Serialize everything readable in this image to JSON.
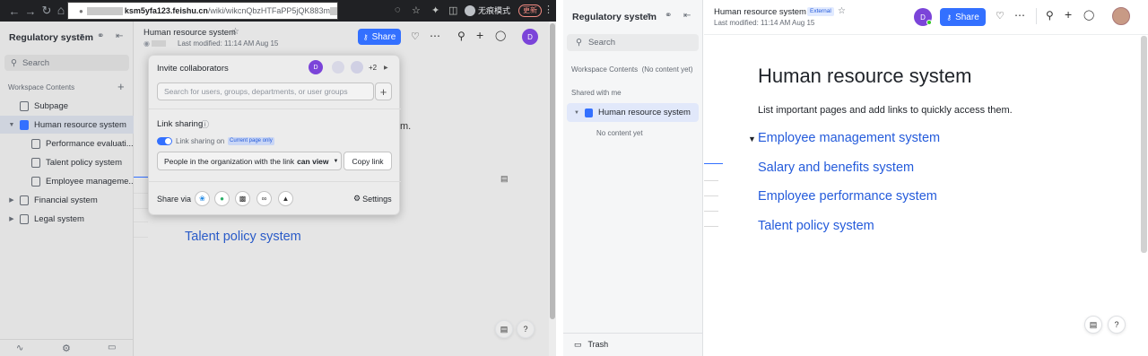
{
  "browser": {
    "url_prefix": "ksm5yfa123.feishu.cn",
    "url_path": "/wiki/wikcnQbzHTFaPP5jQK883m",
    "incognito_label": "无痕模式",
    "update_label": "更新"
  },
  "left": {
    "workspace_name": "Regulatory system",
    "search_placeholder": "Search",
    "workspace_contents_label": "Workspace Contents",
    "tree": [
      {
        "label": "Subpage"
      },
      {
        "label": "Human resource system"
      },
      {
        "label": "Performance evaluati..."
      },
      {
        "label": "Talent policy system"
      },
      {
        "label": "Employee manageme..."
      },
      {
        "label": "Financial system"
      },
      {
        "label": "Legal system"
      }
    ],
    "doc_title": "Human resource system",
    "last_modified": "Last modified: 11:14 AM Aug 15",
    "share_label": "Share",
    "avatar_letter": "D",
    "body_fragment": "m.",
    "toc_visible": "Talent policy system"
  },
  "popup": {
    "invite_title": "Invite collaborators",
    "more_count": "+2",
    "invite_avatar": "D",
    "search_placeholder": "Search for users, groups, departments, or user groups",
    "link_sharing_title": "Link sharing",
    "link_sharing_on": "Link sharing on",
    "current_page_badge": "Current page only",
    "permission_text": "People in the organization with the link",
    "permission_bold": "can view",
    "copy_link": "Copy link",
    "share_via": "Share via",
    "settings": "Settings"
  },
  "right": {
    "workspace_name": "Regulatory system",
    "search_placeholder": "Search",
    "workspace_contents_label": "Workspace Contents",
    "no_content_yet": "(No content yet)",
    "shared_with_me": "Shared with me",
    "shared_item": "Human resource system",
    "shared_empty": "No content yet",
    "trash": "Trash",
    "doc_title": "Human resource system",
    "external_badge": "External",
    "last_modified": "Last modified: 11:14 AM Aug 15",
    "share_label": "Share",
    "avatar_letter": "D",
    "page_heading": "Human resource system",
    "intro_text": "List important pages and add links to quickly access them.",
    "toc": [
      {
        "label": "Employee management system"
      },
      {
        "label": "Salary and benefits system"
      },
      {
        "label": "Employee performance system"
      },
      {
        "label": "Talent policy system"
      }
    ]
  },
  "colors": {
    "accent": "#3370ff",
    "link": "#245bdb",
    "avatar": "#7b44d9"
  }
}
